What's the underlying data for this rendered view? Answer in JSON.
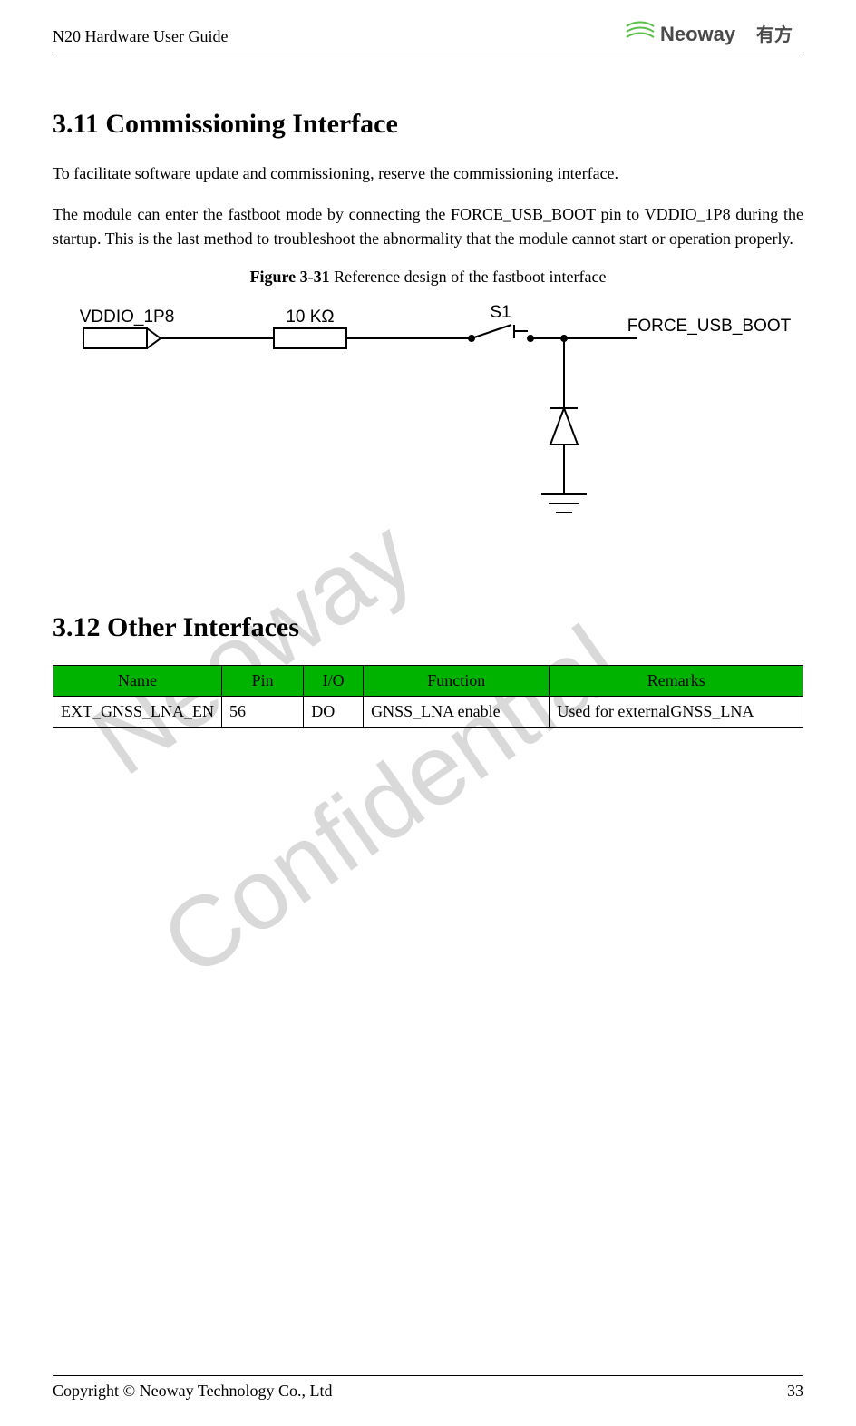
{
  "header": {
    "doc_title": "N20 Hardware User Guide",
    "logo_text": "Neoway 有方"
  },
  "section1": {
    "heading": "3.11  Commissioning Interface",
    "para1": "To facilitate software update and commissioning, reserve the commissioning interface.",
    "para2": "The module can enter the fastboot mode by connecting the FORCE_USB_BOOT pin to VDDIO_1P8 during the startup. This is the last method to troubleshoot the abnormality that the module cannot start or operation properly.",
    "figure_label": "Figure 3-31",
    "figure_caption": " Reference design of the fastboot interface"
  },
  "diagram": {
    "label_vddio": "VDDIO_1P8",
    "label_resistor": "10 KΩ",
    "label_switch": "S1",
    "label_force": "FORCE_USB_BOOT"
  },
  "section2": {
    "heading": "3.12  Other Interfaces"
  },
  "table": {
    "headers": {
      "name": "Name",
      "pin": "Pin",
      "io": "I/O",
      "function": "Function",
      "remarks": "Remarks"
    },
    "rows": [
      {
        "name": "EXT_GNSS_LNA_EN",
        "pin": "56",
        "io": "DO",
        "function": "GNSS_LNA enable",
        "remarks": "Used for externalGNSS_LNA"
      }
    ]
  },
  "watermark": {
    "text1": "Neoway",
    "text2": "Confidential"
  },
  "footer": {
    "copyright": "Copyright © Neoway Technology Co., Ltd",
    "page_number": "33"
  }
}
